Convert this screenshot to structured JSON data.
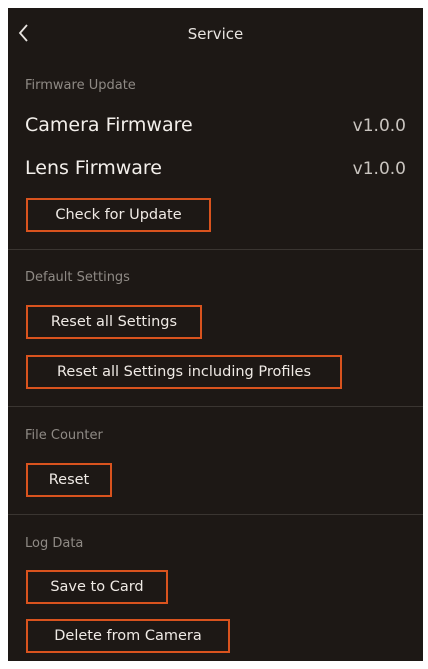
{
  "header": {
    "title": "Service"
  },
  "firmware": {
    "section_title": "Firmware Update",
    "camera_label": "Camera Firmware",
    "camera_version": "v1.0.0",
    "lens_label": "Lens Firmware",
    "lens_version": "v1.0.0",
    "check_button": "Check for Update"
  },
  "defaults": {
    "section_title": "Default Settings",
    "reset_all": "Reset all Settings",
    "reset_all_profiles": "Reset all Settings including Profiles"
  },
  "file_counter": {
    "section_title": "File Counter",
    "reset": "Reset"
  },
  "log_data": {
    "section_title": "Log Data",
    "save_to_card": "Save to Card",
    "delete_from_camera": "Delete from Camera"
  },
  "colors": {
    "background": "#1d1815",
    "accent_border": "#d9531e"
  }
}
